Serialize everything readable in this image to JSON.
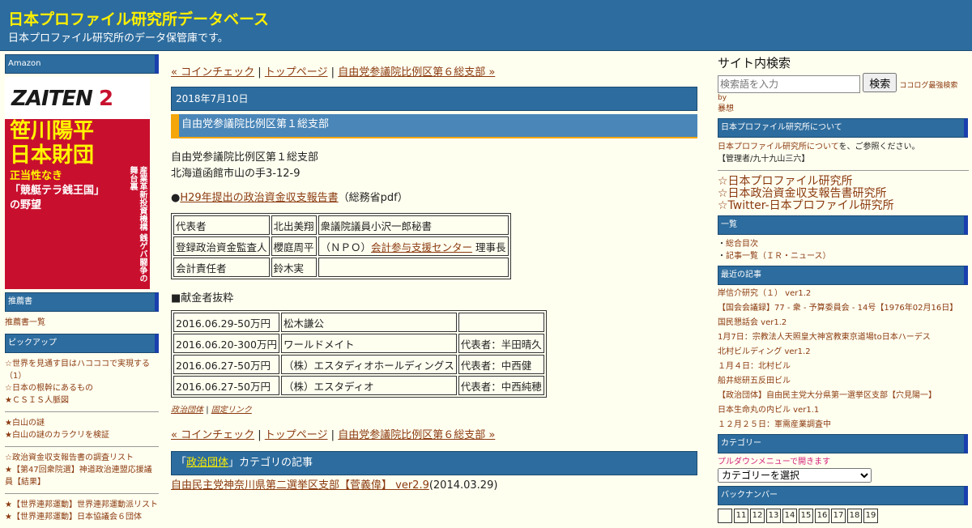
{
  "header": {
    "title": "日本プロファイル研究所データベース",
    "description": "日本プロファイル研究所のデータ保管庫です。"
  },
  "left": {
    "amazon_head": "Amazon",
    "book": {
      "top": "ZAITEN",
      "issue": "2",
      "big1": "笹川陽平",
      "big2": "日本財団",
      "sub1": "正当性なき",
      "sub2": "「競艇テラ銭王国」",
      "sub3": "の野望",
      "side": "産業革新投資機構 銭ゲバ闘争の舞台裏"
    },
    "recommend_head": "推薦書",
    "recommend_link": "推薦書一覧",
    "pickup_head": "ピックアップ",
    "pickup": [
      [
        "☆世界を見通す目はハコココで実現する（1）",
        "☆日本の根幹にあるもの",
        "★ＣＳＩＳ人脈図"
      ],
      [
        "★白山の謎",
        "★白山の謎のカラクリを検証"
      ],
      [
        "☆政治資金収支報告書の調査リスト",
        "★【第47回衆院選】神道政治連盟応援議員【結果】"
      ],
      [
        "★【世界連邦運動】世界連邦運動派リスト",
        "★【世界連邦運動】日本協議会６団体"
      ]
    ]
  },
  "main": {
    "nav": {
      "prev": "« コインチェック",
      "sep": "|",
      "top": "トップページ",
      "next": "自由党参議院比例区第６総支部 »"
    },
    "date": "2018年7月10日",
    "title": "自由党参議院比例区第１総支部",
    "address_line1": "自由党参議院比例区第１総支部",
    "address_line2": "北海道函館市山の手3-12-9",
    "report_prefix": "●",
    "report_link": "H29年提出の政治資金収支報告書",
    "report_suffix": "（総務省pdf）",
    "officers": [
      {
        "role": "代表者",
        "name": "北出美翔",
        "note": "衆議院議員小沢一郎秘書"
      },
      {
        "role": "登録政治資金監査人",
        "name": "櫻庭周平",
        "note_pre": "（ＮＰＯ）",
        "note_link": "会計参与支援センター",
        "note_post": " 理事長"
      },
      {
        "role": "会計責任者",
        "name": "鈴木実",
        "note": ""
      }
    ],
    "donors_head": "■献金者抜粋",
    "donors": [
      {
        "date": "2016.06.29-50万円",
        "name": "松木謙公",
        "rep": ""
      },
      {
        "date": "2016.06.20-300万円",
        "name": "ワールドメイト",
        "rep": "代表者：半田晴久"
      },
      {
        "date": "2016.06.27-50万円",
        "name": "（株）エスタディオホールディングス",
        "rep": "代表者：中西健"
      },
      {
        "date": "2016.06.27-50万円",
        "name": "（株）エスタディオ",
        "rep": "代表者：中西純穂"
      }
    ],
    "footer_category": "政治団体",
    "footer_sep": "|",
    "footer_permalink": "固定リンク",
    "category_bar_pre": "「",
    "category_bar_link": "政治団体",
    "category_bar_post": "」カテゴリの記事",
    "category_article_link": "自由民主党神奈川県第二選挙区支部【菅義偉】 ver2.9",
    "category_article_date": "(2014.03.29)"
  },
  "right": {
    "search_title": "サイト内検索",
    "search_placeholder": "検索語を入力",
    "search_button": "検索",
    "search_powered1": "ココログ最強検索 by",
    "search_powered2": "暴想",
    "about_head": "日本プロファイル研究所について",
    "about_text_link": "日本プロファイル研究所について",
    "about_text_post": "を、ご参照ください。",
    "admin": "【管理者/九十九山三六】",
    "links": [
      "☆日本プロファイル研究所",
      "☆日本政治資金収支報告書研究所",
      "☆Twitter-日本プロファイル研究所"
    ],
    "list_head": "一覧",
    "list_items": [
      "総合目次",
      "記事一覧（ＩＲ・ニュース）"
    ],
    "recent_head": "最近の記事",
    "recent": [
      "岸信介研究（１） ver1.2",
      "【国会会議録】77 - 衆 - 予算委員会 - 14号【1976年02月16日】",
      "国民懇話会 ver1.2",
      "1月7日：宗教法人天照皇大神宮教東京道場to日本ハーデス",
      "北村ビルディング ver1.2",
      "１月４日：北村ビル",
      "船井総研五反田ビル",
      "【政治団体】自由民主党大分県第一選挙区支部【穴見陽一】",
      "日本生命丸の内ビル ver1.1",
      "１２月２５日：軍需産業調査中"
    ],
    "category_head": "カテゴリー",
    "category_hint": "プルダウンメニューで開きます",
    "category_select": "カテゴリーを選択",
    "backnumber_head": "バックナンバー",
    "backnumbers": [
      "",
      "11",
      "12",
      "13",
      "14",
      "15",
      "16",
      "17",
      "18",
      "19"
    ]
  },
  "colors": {
    "header_bg": "#2d6c9e",
    "title_yellow": "#fff000",
    "accent_orange": "#f5a60a",
    "link": "#8b3a10"
  }
}
